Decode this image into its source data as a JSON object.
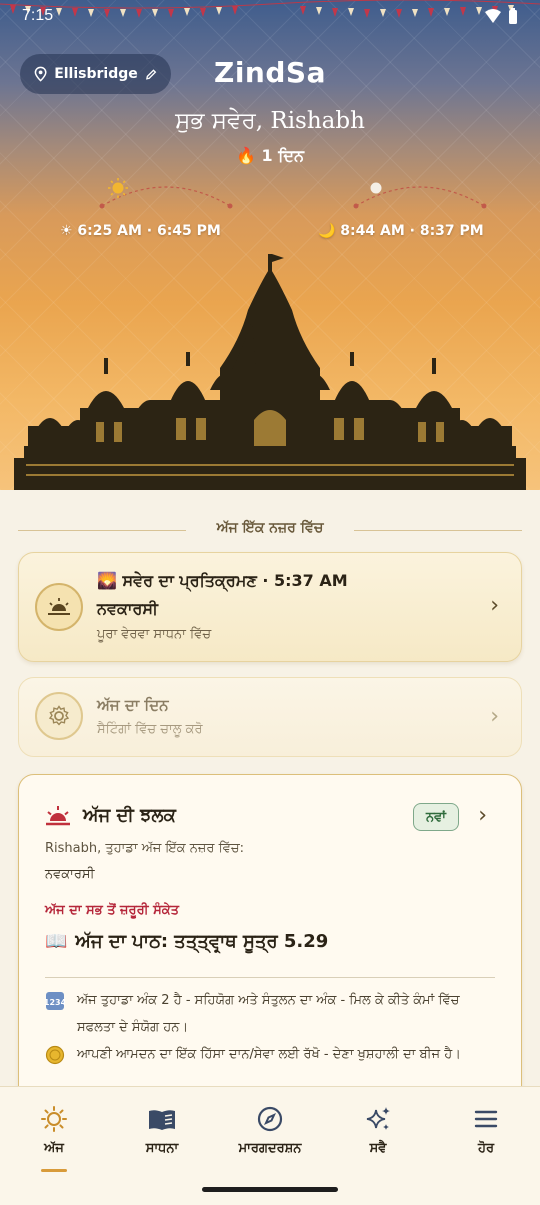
{
  "status_bar": {
    "time": "7:15"
  },
  "header": {
    "location": "Ellisbridge",
    "app_title": "ZindSa",
    "greeting": "ਸੁਭ ਸਵੇਰ, Rishabh",
    "streak": "1 ਦਿਨ",
    "sun_times": "☀ 6:25 AM · 6:45 PM",
    "moon_times": "🌙 8:44 AM · 8:37 PM"
  },
  "section": {
    "title": "ਅੱਜ ਇੱਕ ਨਜ਼ਰ ਵਿੱਚ"
  },
  "pratikraman_card": {
    "title": "🌄 ਸਵੇਰ ਦਾ ਪ੍ਰਤਿਕ੍ਰਮਣ · 5:37 AM",
    "subtitle": "ਨਵਕਾਰਸੀ",
    "note": "ਪੂਰਾ ਵੇਰਵਾ ਸਾਧਨਾ ਵਿੱਚ"
  },
  "day_card": {
    "title": "ਅੱਜ ਦਾ ਦਿਨ",
    "note": "ਸੈਟਿੰਗਾਂ ਵਿੱਚ ਚਾਲੂ ਕਰੋ"
  },
  "glimpse_card": {
    "title": "ਅੱਜ ਦੀ ਝਲਕ",
    "badge": "ਨਵਾਂ",
    "line1": "Rishabh, ਤੁਹਾਡਾ ਅੱਜ ਇੱਕ ਨਜ਼ਰ ਵਿੱਚ:",
    "line2": "ਨਵਕਾਰਸੀ",
    "alert": "ਅੱਜ ਦਾ ਸਭ ਤੋਂ ਜ਼ਰੂਰੀ ਸੰਕੇਤ",
    "path": "ਅੱਜ ਦਾ ਪਾਠ: ਤਤ੍ਤ੍ਵਾਰ੍ਥ ਸੂਤ੍ਰ 5.29",
    "tip1": "ਅੱਜ ਤੁਹਾਡਾ ਅੰਕ 2 ਹੈ - ਸਹਿਯੋਗ ਅਤੇ ਸੰਤੁਲਨ ਦਾ ਅੰਕ - ਮਿਲ ਕੇ ਕੀਤੇ ਕੰਮਾਂ ਵਿੱਚ ਸਫਲਤਾ ਦੇ ਸੰਯੋਗ ਹਨ।",
    "tip2": "ਆਪਣੀ ਆਮਦਨ ਦਾ ਇੱਕ ਹਿੱਸਾ ਦਾਨ/ਸੇਵਾ ਲਈ ਰੱਖੋ - ਦੇਣਾ ਖੁਸ਼ਹਾਲੀ ਦਾ ਬੀਜ ਹੈ।"
  },
  "bottom_nav": {
    "items": [
      {
        "label": "ਅੱਜ",
        "icon": "sun-icon",
        "active": true
      },
      {
        "label": "ਸਾਧਨਾ",
        "icon": "book-icon"
      },
      {
        "label": "ਮਾਰਗਦਰਸ਼ਨ",
        "icon": "compass-icon"
      },
      {
        "label": "ਸਵੈ",
        "icon": "sparkle-icon"
      },
      {
        "label": "ਹੋਰ",
        "icon": "menu-icon"
      }
    ]
  }
}
